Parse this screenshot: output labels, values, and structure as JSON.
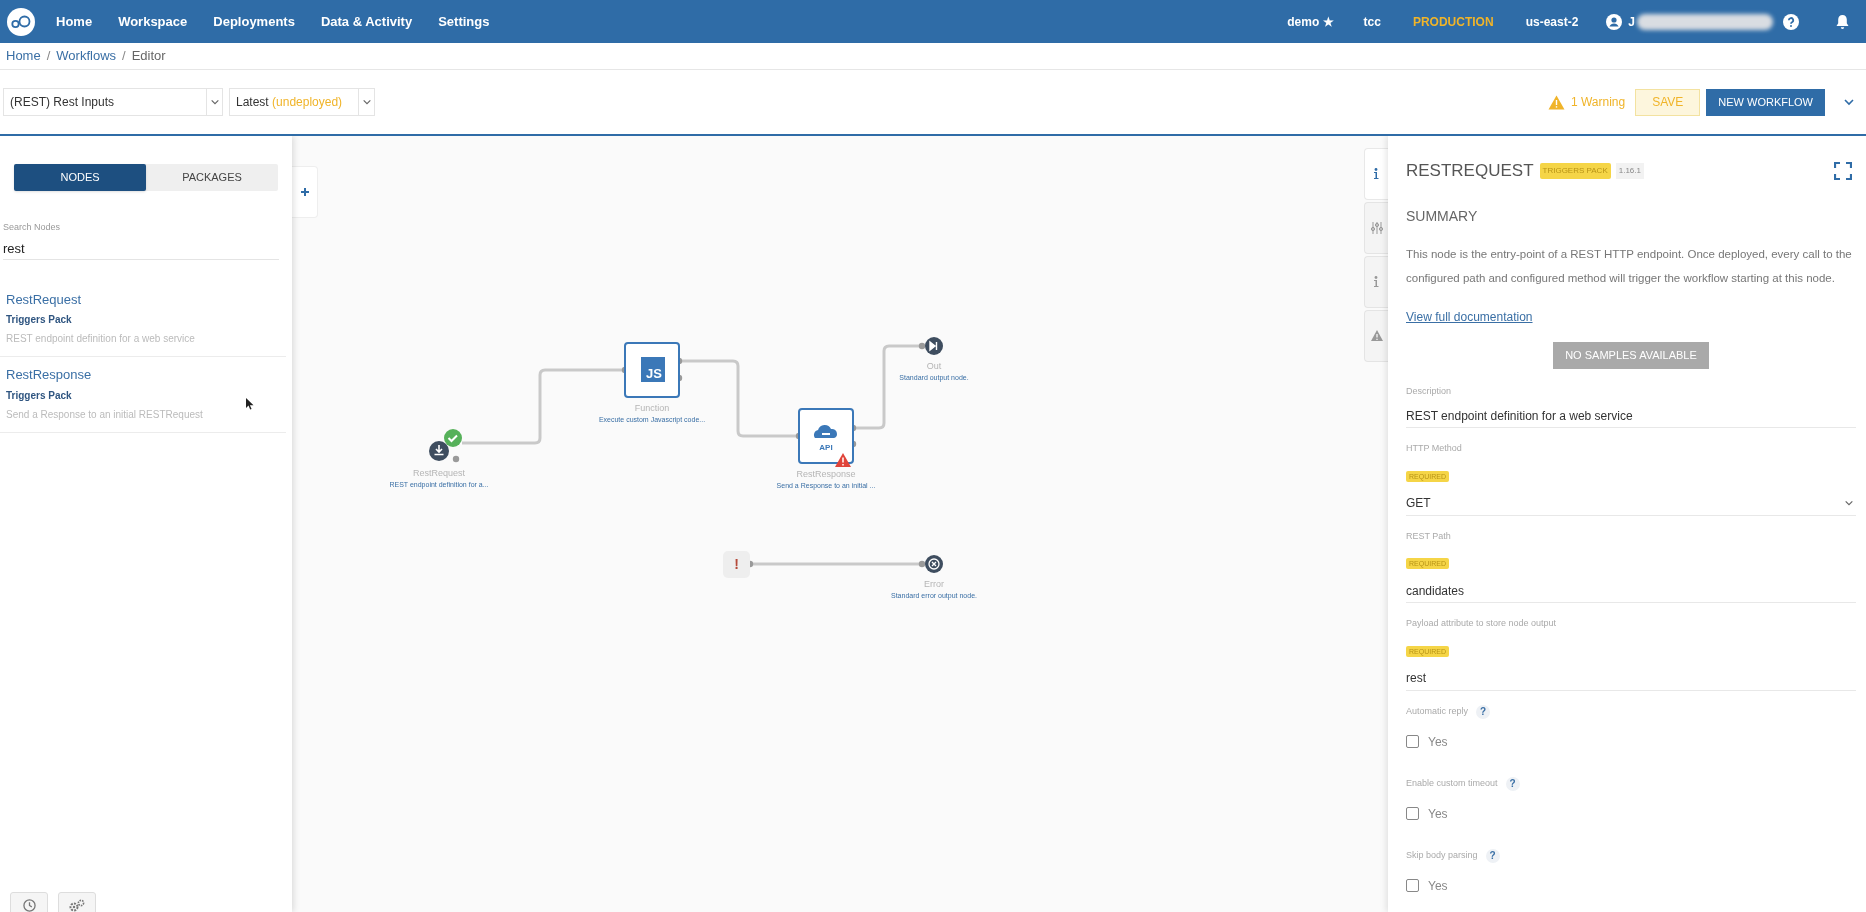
{
  "navbar": {
    "links": [
      "Home",
      "Workspace",
      "Deployments",
      "Data & Activity",
      "Settings"
    ],
    "org": "demo ★",
    "tenant": "tcc",
    "environment": "PRODUCTION",
    "region": "us-east-2",
    "user": "J"
  },
  "breadcrumb": [
    {
      "kind": "link",
      "label": "Home"
    },
    {
      "kind": "separator",
      "label": "/"
    },
    {
      "kind": "link",
      "label": "Workflows"
    },
    {
      "kind": "separator",
      "label": "/"
    },
    {
      "kind": "current",
      "label": "Editor"
    }
  ],
  "toolbar": {
    "workflow": "(REST) Rest Inputs",
    "version": "Latest",
    "version_status": "(undeployed)",
    "warning": "1 Warning",
    "save": "SAVE",
    "new_workflow": "NEW WORKFLOW"
  },
  "left_panel": {
    "tabs": [
      {
        "label": "NODES",
        "selected": true
      },
      {
        "label": "PACKAGES",
        "selected": false
      }
    ],
    "search": {
      "label": "Search Nodes",
      "value": "rest"
    },
    "results": [
      {
        "name": "RestRequest",
        "package": "Triggers Pack",
        "description": "REST endpoint definition for a web service"
      },
      {
        "name": "RestResponse",
        "package": "Triggers Pack",
        "description": "Send a Response to an initial RESTRequest"
      }
    ]
  },
  "canvas": {
    "nodes": [
      {
        "kind": "trigger",
        "name": "RestRequest",
        "description": "REST endpoint definition for a...",
        "valid": true,
        "warning": false
      },
      {
        "kind": "function",
        "name": "Function",
        "description": "Execute custom Javascript code...",
        "icon_text": "JS",
        "valid": false,
        "warning": false
      },
      {
        "kind": "api",
        "name": "RestResponse",
        "description": "Send a Response to an initial ...",
        "icon_text": "API",
        "valid": false,
        "warning": true
      },
      {
        "kind": "output",
        "name": "Out",
        "description": "Standard output node.",
        "valid": false,
        "warning": false
      },
      {
        "kind": "error_trigger",
        "icon_text": "!",
        "valid": false,
        "warning": false
      },
      {
        "kind": "error_output",
        "name": "Error",
        "description": "Standard error output node.",
        "valid": false,
        "warning": false
      }
    ]
  },
  "detail_panel": {
    "side_tabs": [
      {
        "kind": "info",
        "selected": true
      },
      {
        "kind": "settings",
        "selected": false
      },
      {
        "kind": "info",
        "selected": false
      },
      {
        "kind": "warning",
        "selected": false
      }
    ],
    "title": "RESTREQUEST",
    "package": "TRIGGERS PACK",
    "version": "1.16.1",
    "section": "SUMMARY",
    "summary": "This node is the entry-point of a REST HTTP endpoint. Once deployed, every call to the configured path and configured method will trigger the workflow starting at this node.",
    "doc_link": "View full documentation",
    "samples_button": {
      "label": "NO SAMPLES AVAILABLE",
      "disabled": true
    },
    "fields": [
      {
        "kind": "text",
        "label": "Description",
        "value": "REST endpoint definition for a web service"
      },
      {
        "kind": "select",
        "label": "HTTP Method",
        "badge": "REQUIRED",
        "value": "GET"
      },
      {
        "kind": "text",
        "label": "REST Path",
        "badge": "REQUIRED",
        "value": "candidates"
      },
      {
        "kind": "text",
        "label": "Payload attribute to store node output",
        "badge": "REQUIRED",
        "value": "rest"
      },
      {
        "kind": "checkbox",
        "label": "Automatic reply",
        "help": "?",
        "option": "Yes",
        "checked": false
      },
      {
        "kind": "checkbox",
        "label": "Enable custom timeout",
        "help": "?",
        "option": "Yes",
        "checked": false
      },
      {
        "kind": "checkbox",
        "label": "Skip body parsing",
        "help": "?",
        "option": "Yes",
        "checked": false
      }
    ]
  }
}
